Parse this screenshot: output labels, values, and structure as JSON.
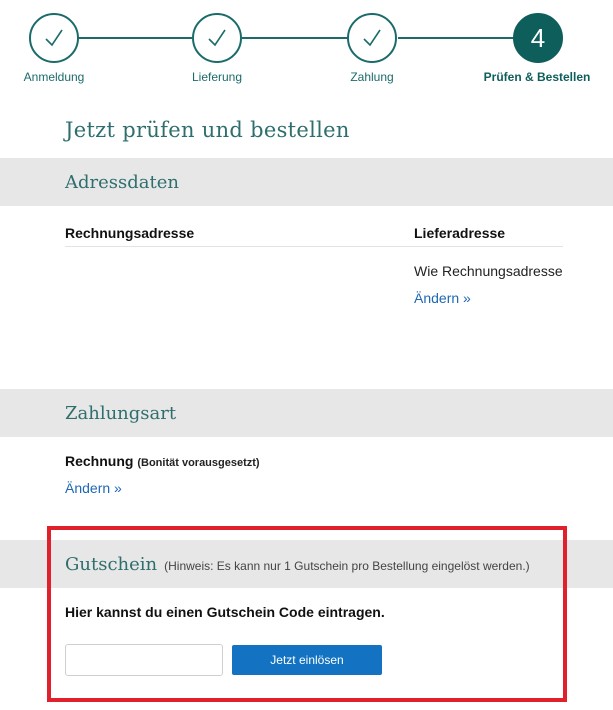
{
  "stepper": {
    "steps": [
      {
        "label": "Anmeldung",
        "state": "done",
        "icon": "check-icon"
      },
      {
        "label": "Lieferung",
        "state": "done",
        "icon": "check-icon"
      },
      {
        "label": "Zahlung",
        "state": "done",
        "icon": "check-icon"
      },
      {
        "label": "Prüfen & Bestellen",
        "state": "active",
        "number": "4"
      }
    ]
  },
  "page": {
    "title": "Jetzt prüfen und bestellen"
  },
  "address": {
    "section_title": "Adressdaten",
    "billing_heading": "Rechnungsadresse",
    "shipping_heading": "Lieferadresse",
    "shipping_value": "Wie Rechnungsadresse",
    "change_link": "Ändern »"
  },
  "payment": {
    "section_title": "Zahlungsart",
    "method": "Rechnung",
    "method_note": "(Bonität vorausgesetzt)",
    "change_link": "Ändern »"
  },
  "voucher": {
    "section_title": "Gutschein",
    "hint": "(Hinweis: Es kann nur 1 Gutschein pro Bestellung eingelöst werden.)",
    "prompt": "Hier kannst du einen Gutschein Code eintragen.",
    "input_value": "",
    "button_label": "Jetzt einlösen"
  },
  "colors": {
    "brand_teal": "#0e5e5c",
    "link_blue": "#1f67b3",
    "button_blue": "#1373c2",
    "highlight_red": "#e0202a",
    "section_gray": "#e7e7e7"
  }
}
